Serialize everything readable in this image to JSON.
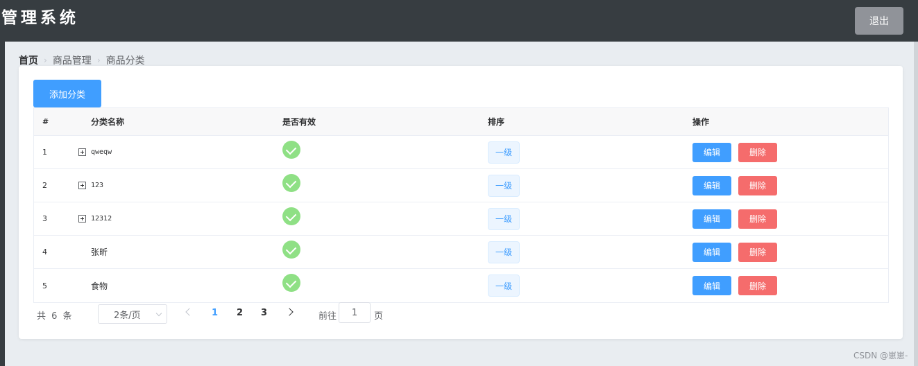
{
  "header": {
    "title": "管理系统",
    "logout_label": "退出"
  },
  "breadcrumb": [
    "首页",
    "商品管理",
    "商品分类"
  ],
  "toolbar": {
    "add_label": "添加分类"
  },
  "table": {
    "columns": [
      "#",
      "分类名称",
      "是否有效",
      "排序",
      "操作"
    ],
    "rows": [
      {
        "index": "1",
        "name": "qweqw",
        "expandable": true,
        "valid": true,
        "sort": "一级",
        "edit": "编辑",
        "delete": "删除"
      },
      {
        "index": "2",
        "name": "123",
        "expandable": true,
        "valid": true,
        "sort": "一级",
        "edit": "编辑",
        "delete": "删除"
      },
      {
        "index": "3",
        "name": "12312",
        "expandable": true,
        "valid": true,
        "sort": "一级",
        "edit": "编辑",
        "delete": "删除"
      },
      {
        "index": "4",
        "name": "张昕",
        "expandable": false,
        "valid": true,
        "sort": "一级",
        "edit": "编辑",
        "delete": "删除"
      },
      {
        "index": "5",
        "name": "食物",
        "expandable": false,
        "valid": true,
        "sort": "一级",
        "edit": "编辑",
        "delete": "删除"
      }
    ]
  },
  "pagination": {
    "total": "共 6 条",
    "page_size": "2条/页",
    "pages": [
      "1",
      "2",
      "3"
    ],
    "current": "1",
    "goto_label": "前往",
    "goto_value": "1",
    "page_suffix": "页"
  },
  "watermark": "CSDN @崽崽-",
  "colors": {
    "primary": "#409eff",
    "danger": "#f56c6c",
    "success": "#8fe085",
    "header": "#373d41"
  }
}
